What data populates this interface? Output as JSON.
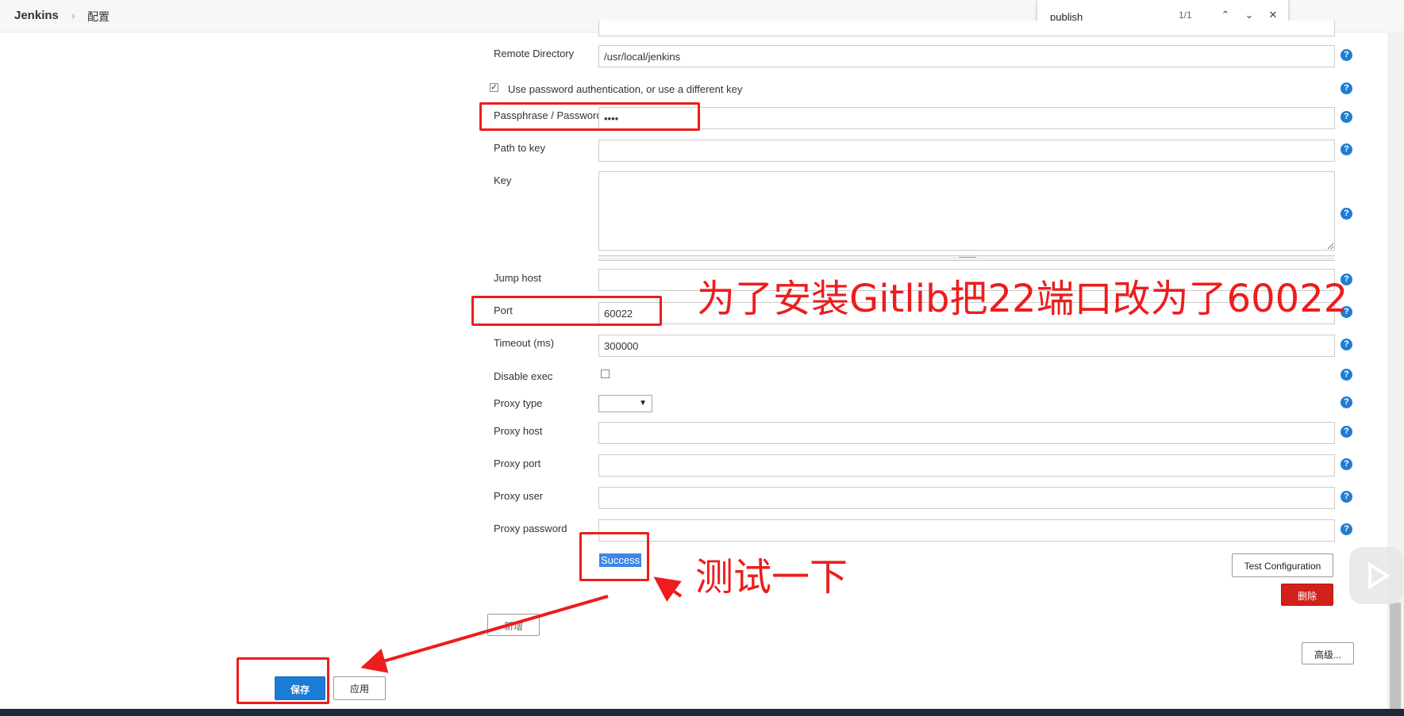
{
  "header": {
    "brand": "Jenkins",
    "separator": "›",
    "crumb": "配置"
  },
  "find": {
    "value": "publish",
    "count": "1/1"
  },
  "form": {
    "remote_directory": {
      "label": "Remote Directory",
      "value": "/usr/local/jenkins"
    },
    "use_password": {
      "label": "Use password authentication, or use a different key",
      "checked": true
    },
    "passphrase": {
      "label": "Passphrase / Password",
      "value": "••••"
    },
    "path_to_key": {
      "label": "Path to key",
      "value": ""
    },
    "key": {
      "label": "Key",
      "value": ""
    },
    "jump_host": {
      "label": "Jump host",
      "value": ""
    },
    "port": {
      "label": "Port",
      "value": "60022"
    },
    "timeout": {
      "label": "Timeout (ms)",
      "value": "300000"
    },
    "disable_exec": {
      "label": "Disable exec",
      "checked": false
    },
    "proxy_type": {
      "label": "Proxy type",
      "value": ""
    },
    "proxy_host": {
      "label": "Proxy host",
      "value": ""
    },
    "proxy_port": {
      "label": "Proxy port",
      "value": ""
    },
    "proxy_user": {
      "label": "Proxy user",
      "value": ""
    },
    "proxy_password": {
      "label": "Proxy password",
      "value": ""
    }
  },
  "status": {
    "success": "Success"
  },
  "buttons": {
    "test": "Test Configuration",
    "delete": "删除",
    "add": "新增",
    "advanced": "高级...",
    "save": "保存",
    "apply": "应用"
  },
  "annotations": {
    "port_note": "为了安装Gitlib把22端口改为了60022",
    "test_note": "测试一下"
  },
  "colors": {
    "annotation": "#ee1c1c",
    "help": "#1f7dd3",
    "primary": "#1a7cd4",
    "danger": "#d2201a"
  }
}
